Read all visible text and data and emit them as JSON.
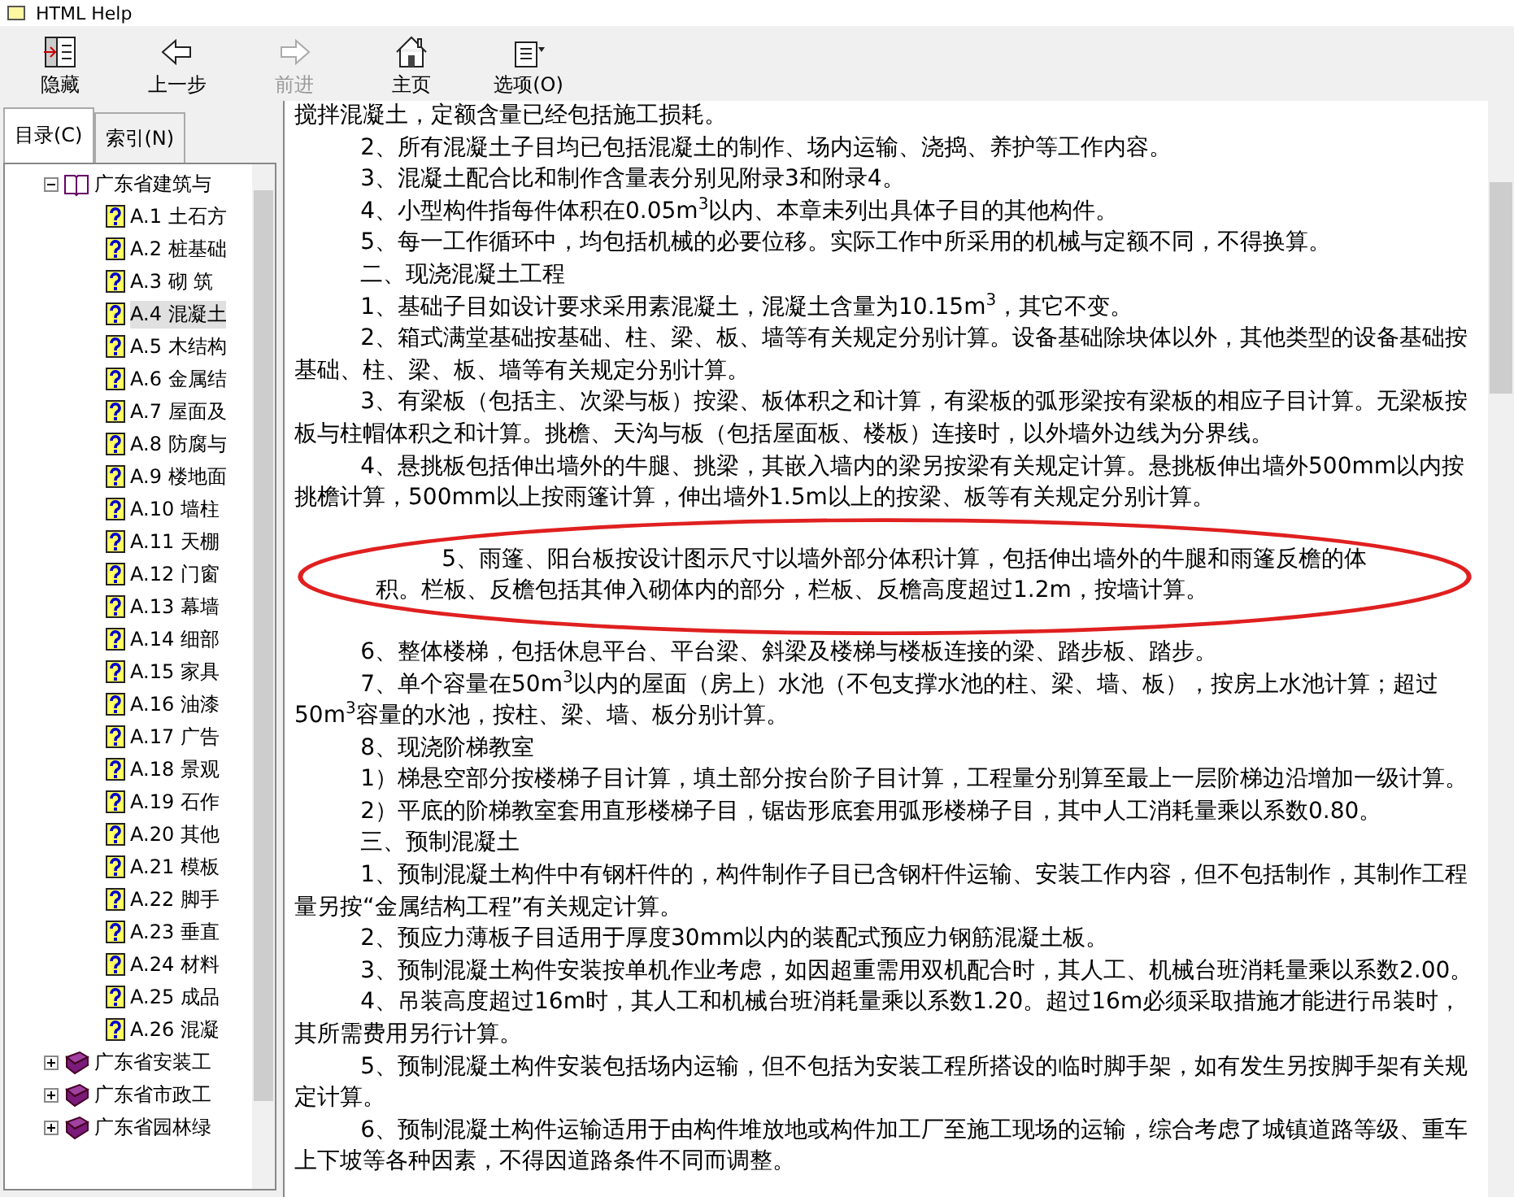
{
  "window": {
    "title": "HTML Help"
  },
  "toolbar": [
    {
      "kind": "hide",
      "label": "隐藏",
      "disabled": false
    },
    {
      "kind": "back",
      "label": "上一步",
      "disabled": false
    },
    {
      "kind": "forward",
      "label": "前进",
      "disabled": true
    },
    {
      "kind": "home",
      "label": "主页",
      "disabled": false
    },
    {
      "kind": "options",
      "label": "选项(O)",
      "disabled": false
    }
  ],
  "tabs": [
    {
      "label": "目录(C)",
      "selected": true
    },
    {
      "label": "索引(N)",
      "selected": false
    }
  ],
  "tree": [
    {
      "label": "广东省建筑与",
      "expanded": true,
      "children": [
        {
          "label": "A.1  土石方",
          "selected": false
        },
        {
          "label": "A.2  桩基础",
          "selected": false
        },
        {
          "label": "A.3  砌  筑",
          "selected": false
        },
        {
          "label": "A.4  混凝土",
          "selected": true
        },
        {
          "label": "A.5  木结构",
          "selected": false
        },
        {
          "label": "A.6  金属结",
          "selected": false
        },
        {
          "label": "A.7 屋面及",
          "selected": false
        },
        {
          "label": "A.8  防腐与",
          "selected": false
        },
        {
          "label": "A.9  楼地面",
          "selected": false
        },
        {
          "label": "A.10  墙柱",
          "selected": false
        },
        {
          "label": "A.11  天棚",
          "selected": false
        },
        {
          "label": "A.12  门窗",
          "selected": false
        },
        {
          "label": "A.13  幕墙",
          "selected": false
        },
        {
          "label": "A.14  细部",
          "selected": false
        },
        {
          "label": "A.15  家具",
          "selected": false
        },
        {
          "label": "A.16  油漆",
          "selected": false
        },
        {
          "label": "A.17  广告",
          "selected": false
        },
        {
          "label": "A.18 景观",
          "selected": false
        },
        {
          "label": "A.19 石作",
          "selected": false
        },
        {
          "label": "A.20  其他",
          "selected": false
        },
        {
          "label": "A.21  模板",
          "selected": false
        },
        {
          "label": "A.22  脚手",
          "selected": false
        },
        {
          "label": "A.23  垂直",
          "selected": false
        },
        {
          "label": "A.24  材料",
          "selected": false
        },
        {
          "label": "A.25  成品",
          "selected": false
        },
        {
          "label": "A.26  混凝",
          "selected": false
        }
      ]
    },
    {
      "label": "广东省安装工",
      "expanded": false
    },
    {
      "label": "广东省市政工",
      "expanded": false
    },
    {
      "label": "广东省园林绿",
      "expanded": false
    }
  ],
  "content": {
    "paragraphs": [
      {
        "kind": "continuation",
        "text": "搅拌混凝土，定额含量已经包括施工损耗。",
        "circled": false
      },
      {
        "kind": "paragraph",
        "text": "2、所有混凝土子目均已包括混凝土的制作、场内运输、浇捣、养护等工作内容。",
        "circled": false
      },
      {
        "kind": "paragraph",
        "text": "3、混凝土配合比和制作含量表分别见附录3和附录4。",
        "circled": false
      },
      {
        "kind": "paragraph",
        "text": "4、小型构件指每件体积在0.05m$^{3}$以内、本章未列出具体子目的其他构件。",
        "circled": false
      },
      {
        "kind": "paragraph",
        "text": "5、每一工作循环中，均包括机械的必要位移。实际工作中所采用的机械与定额不同，不得换算。",
        "circled": false
      },
      {
        "kind": "paragraph",
        "text": "二、现浇混凝土工程",
        "circled": false
      },
      {
        "kind": "paragraph",
        "text": "1、基础子目如设计要求采用素混凝土，混凝土含量为10.15m$^{3}$，其它不变。",
        "circled": false
      },
      {
        "kind": "paragraph",
        "text": "2、箱式满堂基础按基础、柱、梁、板、墙等有关规定分别计算。设备基础除块体以外，其他类型的设备基础按基础、柱、梁、板、墙等有关规定分别计算。",
        "circled": false
      },
      {
        "kind": "paragraph",
        "text": "3、有梁板（包括主、次梁与板）按梁、板体积之和计算，有梁板的弧形梁按有梁板的相应子目计算。无梁板按板与柱帽体积之和计算。挑檐、天沟与板（包括屋面板、楼板）连接时，以外墙外边线为分界线。",
        "circled": false
      },
      {
        "kind": "paragraph",
        "text": "4、悬挑板包括伸出墙外的牛腿、挑梁，其嵌入墙内的梁另按梁有关规定计算。悬挑板伸出墙外500mm以内按挑檐计算，500mm以上按雨篷计算，伸出墙外1.5m以上的按梁、板等有关规定分别计算。",
        "circled": false
      },
      {
        "kind": "paragraph",
        "text": "5、雨篷、阳台板按设计图示尺寸以墙外部分体积计算，包括伸出墙外的牛腿和雨篷反檐的体积。栏板、反檐包括其伸入砌体内的部分，栏板、反檐高度超过1.2m，按墙计算。",
        "circled": true
      },
      {
        "kind": "paragraph",
        "text": "6、整体楼梯，包括休息平台、平台梁、斜梁及楼梯与楼板连接的梁、踏步板、踏步。",
        "circled": false
      },
      {
        "kind": "paragraph",
        "text": "7、单个容量在50m$^{3}$以内的屋面（房上）水池（不包支撑水池的柱、梁、墙、板），按房上水池计算；超过50m$^{3}$容量的水池，按柱、梁、墙、板分别计算。",
        "circled": false
      },
      {
        "kind": "paragraph",
        "text": "8、现浇阶梯教室",
        "circled": false
      },
      {
        "kind": "paragraph",
        "text": "1）梯悬空部分按楼梯子目计算，填土部分按台阶子目计算，工程量分别算至最上一层阶梯边沿增加一级计算。",
        "circled": false
      },
      {
        "kind": "paragraph",
        "text": "2）平底的阶梯教室套用直形楼梯子目，锯齿形底套用弧形楼梯子目，其中人工消耗量乘以系数0.80。",
        "circled": false
      },
      {
        "kind": "paragraph",
        "text": "三、预制混凝土",
        "circled": false
      },
      {
        "kind": "paragraph",
        "text": "1、预制混凝土构件中有钢杆件的，构件制作子目已含钢杆件运输、安装工作内容，但不包括制作，其制作工程量另按“金属结构工程”有关规定计算。",
        "circled": false
      },
      {
        "kind": "paragraph",
        "text": "2、预应力薄板子目适用于厚度30mm以内的装配式预应力钢筋混凝土板。",
        "circled": false
      },
      {
        "kind": "paragraph",
        "text": "3、预制混凝土构件安装按单机作业考虑，如因超重需用双机配合时，其人工、机械台班消耗量乘以系数2.00。",
        "circled": false
      },
      {
        "kind": "paragraph",
        "text": "4、吊装高度超过16m时，其人工和机械台班消耗量乘以系数1.20。超过16m必须采取措施才能进行吊装时，其所需费用另行计算。",
        "circled": false
      },
      {
        "kind": "paragraph",
        "text": "5、预制混凝土构件安装包括场内运输，但不包括为安装工程所搭设的临时脚手架，如有发生另按脚手架有关规定计算。",
        "circled": false
      },
      {
        "kind": "paragraph",
        "text": "6、预制混凝土构件运输适用于由构件堆放地或构件加工厂至施工现场的运输，综合考虑了城镇道路等级、重车上下坡等各种因素，不得因道路条件不同而调整。",
        "circled": false
      }
    ]
  }
}
